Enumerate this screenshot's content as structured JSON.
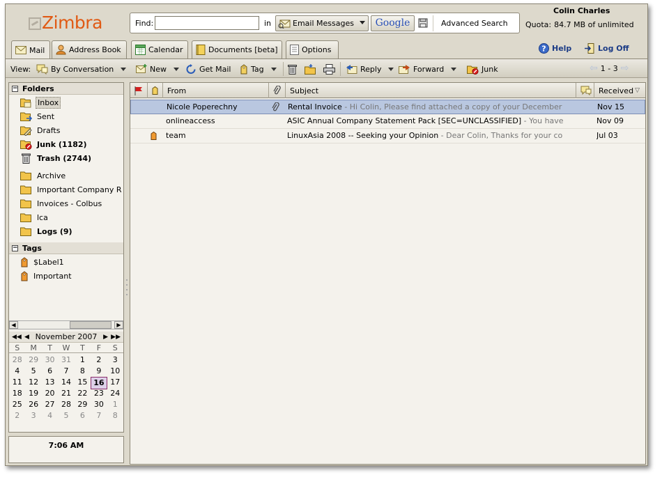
{
  "app": {
    "logo_text": "Zimbra",
    "brand_color": "#e05a14"
  },
  "search": {
    "find_label": "Find:",
    "find_value": "",
    "in_label": "in",
    "scope": "Email Messages",
    "google_label": "Google",
    "advanced_label": "Advanced Search"
  },
  "user": {
    "name": "Colin Charles",
    "quota_label": "Quota:",
    "quota_value": "84.7 MB of unlimited"
  },
  "tabs": [
    {
      "label": "Mail",
      "icon": "mail-envelope-icon"
    },
    {
      "label": "Address Book",
      "icon": "contact-person-icon"
    },
    {
      "label": "Calendar",
      "icon": "calendar-icon"
    },
    {
      "label": "Documents [beta]",
      "icon": "notebook-icon"
    },
    {
      "label": "Options",
      "icon": "options-page-icon"
    }
  ],
  "header_links": {
    "help": "Help",
    "logoff": "Log Off"
  },
  "toolbar": {
    "view_label": "View:",
    "by_conversation": "By Conversation",
    "new": "New",
    "get_mail": "Get Mail",
    "tag": "Tag",
    "reply": "Reply",
    "forward": "Forward",
    "junk": "Junk",
    "pager": "1 - 3"
  },
  "folders": {
    "title": "Folders",
    "items": [
      {
        "label": "Inbox",
        "bold": false
      },
      {
        "label": "Sent",
        "bold": false
      },
      {
        "label": "Drafts",
        "bold": false
      },
      {
        "label": "Junk (1182)",
        "bold": true
      },
      {
        "label": "Trash (2744)",
        "bold": true
      },
      {
        "label": "Archive",
        "bold": false
      },
      {
        "label": "Important Company R",
        "bold": false
      },
      {
        "label": "Invoices - Colbus",
        "bold": false
      },
      {
        "label": "lca",
        "bold": false
      },
      {
        "label": "Logs (9)",
        "bold": true
      }
    ]
  },
  "tags": {
    "title": "Tags",
    "items": [
      {
        "label": "$Label1"
      },
      {
        "label": "Important"
      }
    ]
  },
  "calendar": {
    "month": "November 2007",
    "dow": [
      "S",
      "M",
      "T",
      "W",
      "T",
      "F",
      "S"
    ],
    "weeks": [
      [
        "28",
        "29",
        "30",
        "31",
        "1",
        "2",
        "3"
      ],
      [
        "4",
        "5",
        "6",
        "7",
        "8",
        "9",
        "10"
      ],
      [
        "11",
        "12",
        "13",
        "14",
        "15",
        "16",
        "17"
      ],
      [
        "18",
        "19",
        "20",
        "21",
        "22",
        "23",
        "24"
      ],
      [
        "25",
        "26",
        "27",
        "28",
        "29",
        "30",
        "1"
      ],
      [
        "2",
        "3",
        "4",
        "5",
        "6",
        "7",
        "8"
      ]
    ],
    "today": "16"
  },
  "clock": "7:06 AM",
  "list": {
    "columns": {
      "from": "From",
      "subject": "Subject",
      "received": "Received"
    },
    "rows": [
      {
        "from": "Nicole Poperechny",
        "subject": "Rental Invoice",
        "fragment": " - Hi Colin, Please find attached a copy of your December",
        "date": "Nov 15",
        "attachment": true,
        "tagged": false
      },
      {
        "from": "onlineaccess",
        "subject": "ASIC Annual Company Statement Pack [SEC=UNCLASSIFIED]",
        "fragment": " - You have",
        "date": "Nov 09",
        "attachment": false,
        "tagged": false
      },
      {
        "from": "team",
        "subject": "LinuxAsia 2008 -- Seeking your Opinion",
        "fragment": " - Dear Colin, Thanks for your co",
        "date": "Jul 03",
        "attachment": false,
        "tagged": true
      }
    ]
  }
}
